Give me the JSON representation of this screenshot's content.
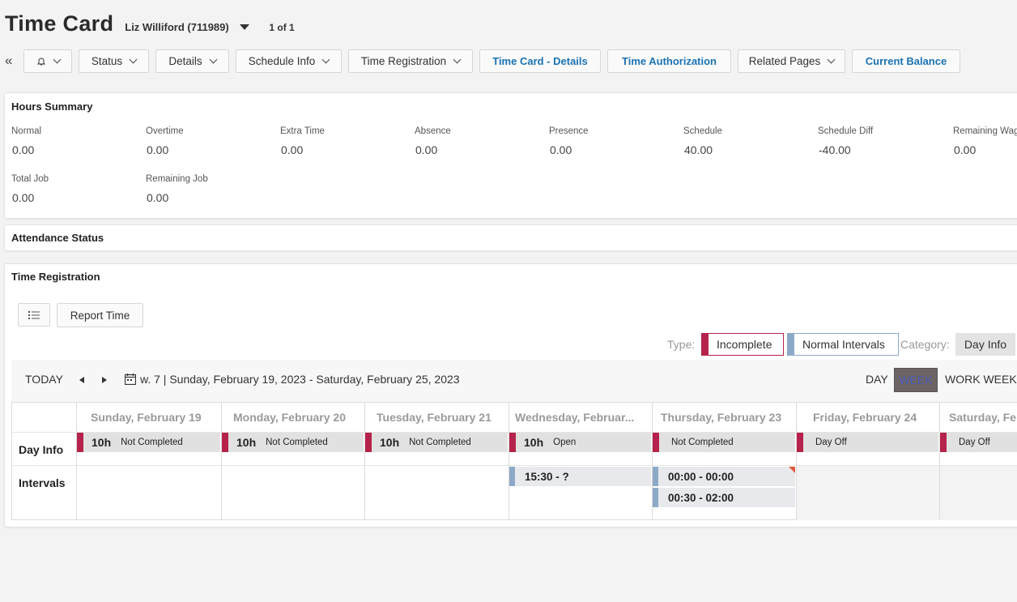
{
  "header": {
    "title": "Time Card",
    "employee": "Liz Williford (711989)",
    "pager": "1 of 1"
  },
  "toolbar": {
    "collapse_glyph": "«",
    "status_label": "Status",
    "details_label": "Details",
    "schedule_info_label": "Schedule Info",
    "time_registration_label": "Time Registration",
    "time_card_details_label": "Time Card - Details",
    "time_authorization_label": "Time Authorization",
    "related_pages_label": "Related Pages",
    "current_balance_label": "Current Balance"
  },
  "hours_summary": {
    "title": "Hours Summary",
    "items": [
      {
        "label": "Normal",
        "value": "0.00"
      },
      {
        "label": "Overtime",
        "value": "0.00"
      },
      {
        "label": "Extra Time",
        "value": "0.00"
      },
      {
        "label": "Absence",
        "value": "0.00"
      },
      {
        "label": "Presence",
        "value": "0.00"
      },
      {
        "label": "Schedule",
        "value": "40.00"
      },
      {
        "label": "Schedule Diff",
        "value": "-40.00"
      },
      {
        "label": "Remaining Wag",
        "value": "0.00"
      },
      {
        "label": "Total Job",
        "value": "0.00"
      },
      {
        "label": "Remaining Job",
        "value": "0.00"
      }
    ]
  },
  "attendance": {
    "title": "Attendance Status"
  },
  "time_registration": {
    "title": "Time Registration",
    "report_time_label": "Report Time",
    "type_label": "Type:",
    "incomplete_label": "Incomplete",
    "normal_intervals_label": "Normal Intervals",
    "category_label": "Category:",
    "day_info_chip": "Day Info",
    "colors": {
      "incomplete": "#b5234a",
      "normal": "#8da9c8"
    }
  },
  "calendar": {
    "today_label": "TODAY",
    "range_label": "w. 7 | Sunday, February 19, 2023 - Saturday, February 25, 2023",
    "view_day": "DAY",
    "view_week": "WEEK",
    "view_work_week": "WORK WEEK",
    "row_day_info": "Day Info",
    "row_intervals": "Intervals",
    "days": [
      {
        "header": "Sunday, February 19",
        "hours": "10h",
        "status": "Not Completed",
        "intervals": []
      },
      {
        "header": "Monday, February 20",
        "hours": "10h",
        "status": "Not Completed",
        "intervals": []
      },
      {
        "header": "Tuesday, February 21",
        "hours": "10h",
        "status": "Not Completed",
        "intervals": []
      },
      {
        "header": "Wednesday, Februar...",
        "hours": "10h",
        "status": "Open",
        "intervals": [
          "15:30 - ?"
        ]
      },
      {
        "header": "Thursday, February 23",
        "hours": "",
        "status": "Not Completed",
        "intervals": [
          "00:00 - 00:00",
          "00:30 - 02:00"
        ]
      },
      {
        "header": "Friday, February 24",
        "hours": "",
        "status": "Day Off",
        "intervals": []
      },
      {
        "header": "Saturday, Fe",
        "hours": "",
        "status": "Day Off",
        "intervals": []
      }
    ]
  }
}
